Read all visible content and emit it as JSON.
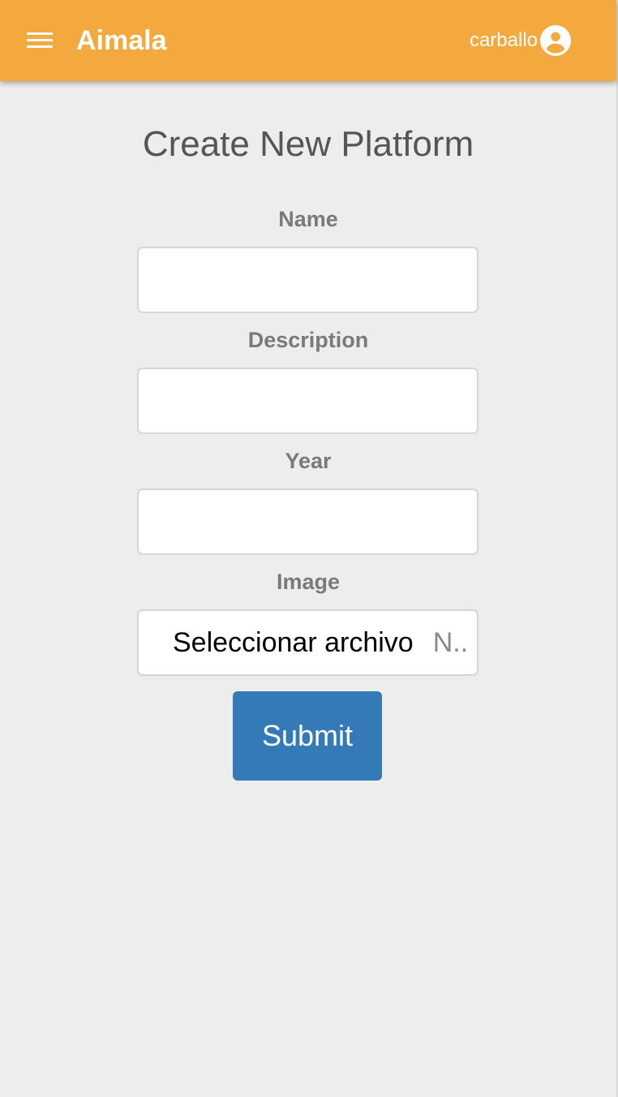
{
  "app_bar": {
    "title": "Aimala",
    "username": "carballo",
    "menu_icon": "hamburger-menu-icon",
    "user_icon": "account-circle-icon",
    "color": "#f3a93e"
  },
  "form": {
    "title": "Create New Platform",
    "fields": [
      {
        "label": "Name",
        "value": "",
        "placeholder": ""
      },
      {
        "label": "Description",
        "value": "",
        "placeholder": ""
      },
      {
        "label": "Year",
        "value": "",
        "placeholder": ""
      }
    ],
    "image": {
      "label": "Image",
      "button_label": "Seleccionar archivo",
      "status_text": "N.."
    },
    "submit_label": "Submit",
    "submit_color": "#337ab7"
  }
}
